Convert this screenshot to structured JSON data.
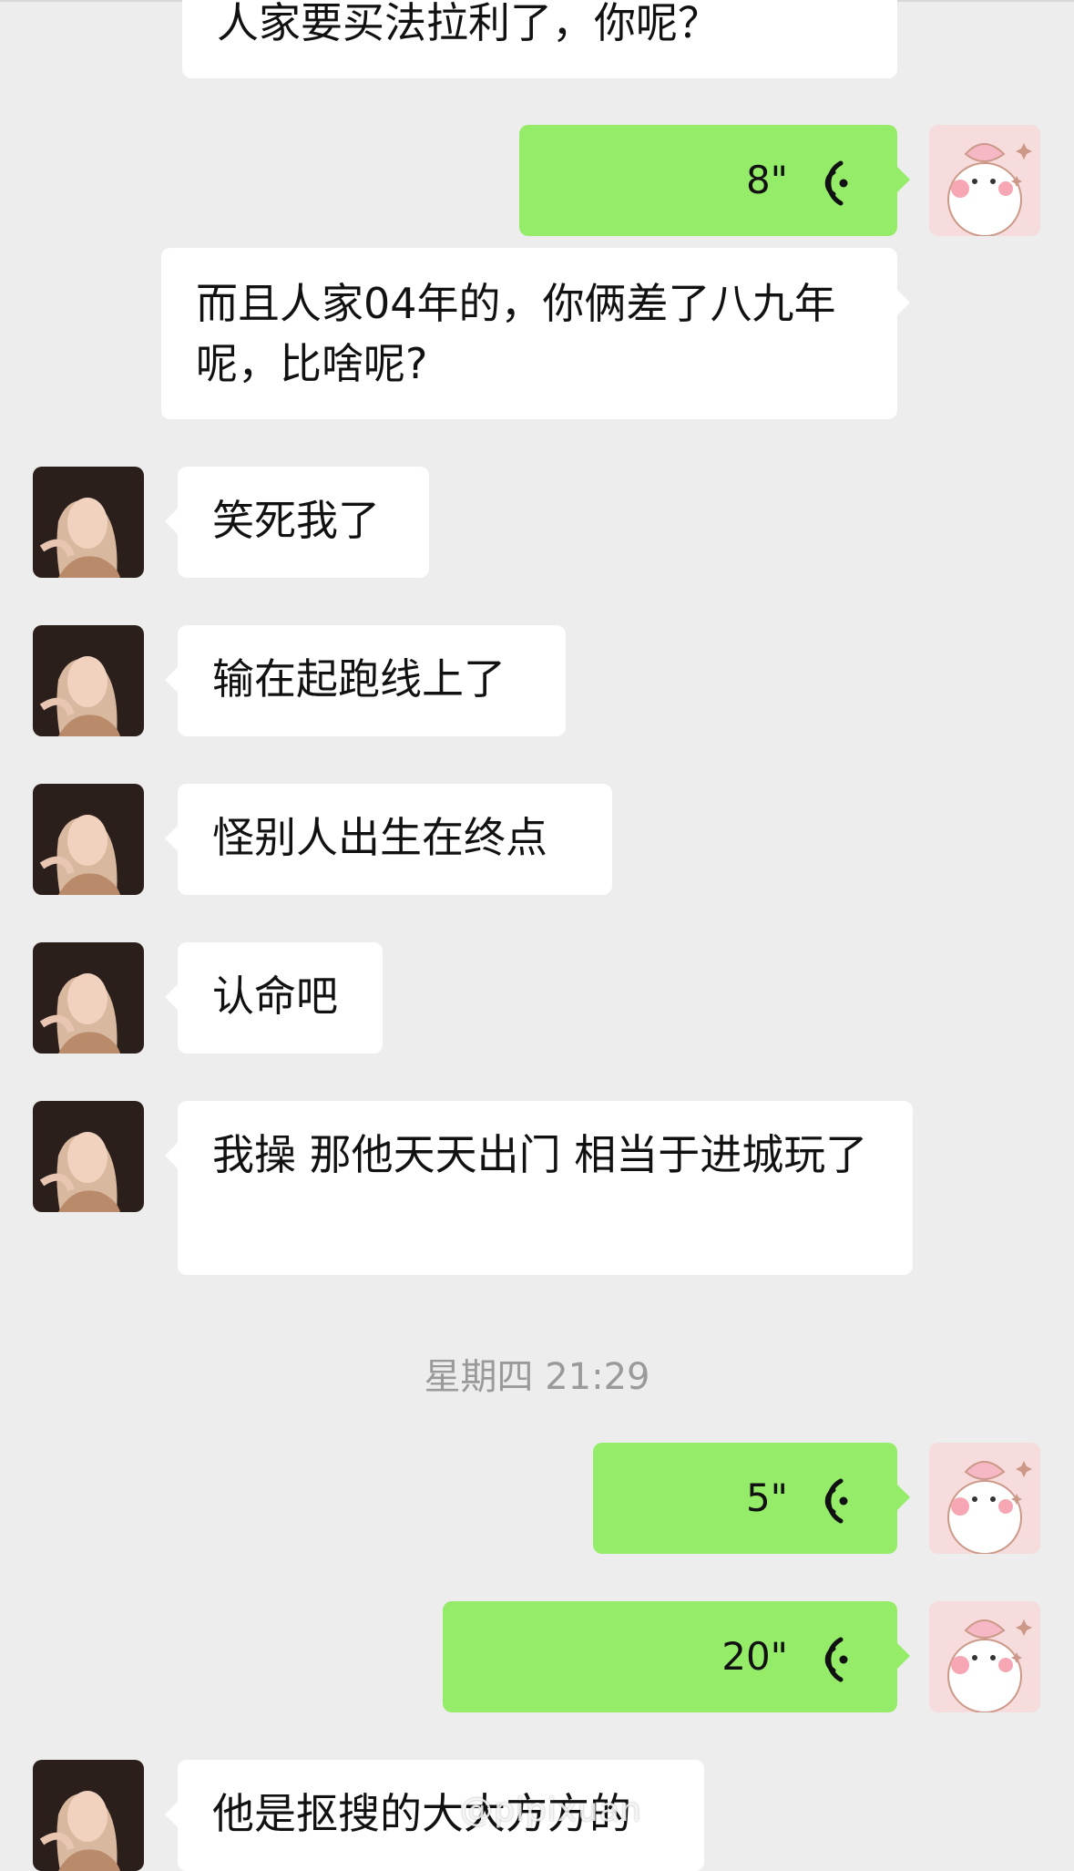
{
  "messages": [
    {
      "id": "m0",
      "side": "out-plain",
      "text": "人家要买法拉利了，你呢？"
    },
    {
      "id": "m1",
      "side": "out",
      "type": "voice",
      "duration": "8\""
    },
    {
      "id": "m2",
      "side": "out-plain",
      "text": "而且人家04年的，你俩差了八九年呢，比啥呢?"
    },
    {
      "id": "m3",
      "side": "in",
      "text": "笑死我了"
    },
    {
      "id": "m4",
      "side": "in",
      "text": "输在起跑线上了"
    },
    {
      "id": "m5",
      "side": "in",
      "text": "怪别人出生在终点"
    },
    {
      "id": "m6",
      "side": "in",
      "text": "认命吧"
    },
    {
      "id": "m7",
      "side": "in",
      "text": "我操 那他天天出门 相当于进城玩了"
    },
    {
      "id": "m8",
      "side": "out",
      "type": "voice",
      "duration": "5\""
    },
    {
      "id": "m9",
      "side": "out",
      "type": "voice",
      "duration": "20\""
    },
    {
      "id": "m10",
      "side": "in",
      "text": "他是抠搜的大大方方的"
    }
  ],
  "timestamp": "星期四 21:29",
  "watermark": "@pipixuan",
  "icons": {
    "voice": "voice-wave-icon",
    "avatar_in": "avatar-girl-photo",
    "avatar_out": "avatar-bunny-sticker"
  },
  "colors": {
    "background": "#ededed",
    "out_bubble": "#95ec69",
    "in_bubble": "#ffffff",
    "timestamp": "#9a9a9a"
  }
}
